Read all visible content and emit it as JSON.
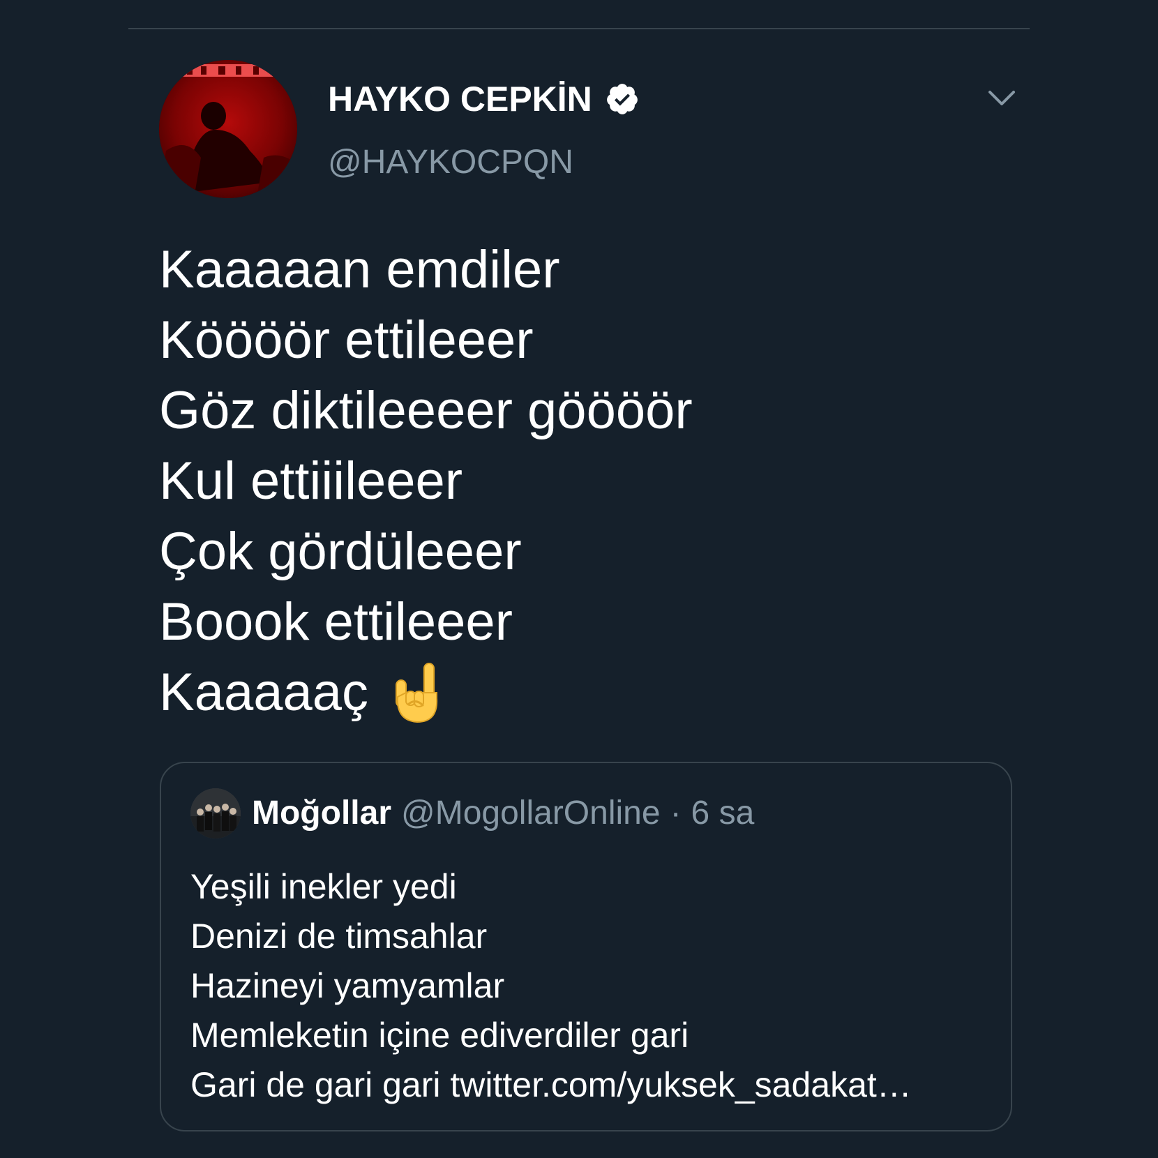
{
  "author": {
    "display_name": "HAYKO CEPKİN",
    "handle": "@HAYKOCPQN",
    "verified_icon": "verified-badge-icon",
    "avatar": "profile-photo-red-toned"
  },
  "more_icon": "chevron-down-icon",
  "tweet": {
    "lines": [
      "Kaaaaan emdiler",
      "Köööör ettileeer",
      "Göz diktileeeer göööör",
      "Kul ettiiileeer",
      "Çok gördüleeer",
      "Boook ettileeer",
      "Kaaaaaç"
    ],
    "emoji": "sign-of-the-horns-icon"
  },
  "quoted_tweet": {
    "display_name": "Moğollar",
    "handle": "@MogollarOnline",
    "separator": "·",
    "time": "6 sa",
    "avatar": "band-photo",
    "lines": [
      "Yeşili inekler yedi",
      "Denizi de timsahlar",
      "Hazineyi yamyamlar",
      "Memleketin içine ediverdiler gari",
      "Gari de gari gari twitter.com/yuksek_sadakat…"
    ]
  },
  "colors": {
    "background": "#15202b",
    "text": "#ffffff",
    "secondary_text": "#8899a6",
    "border": "#38444d"
  }
}
